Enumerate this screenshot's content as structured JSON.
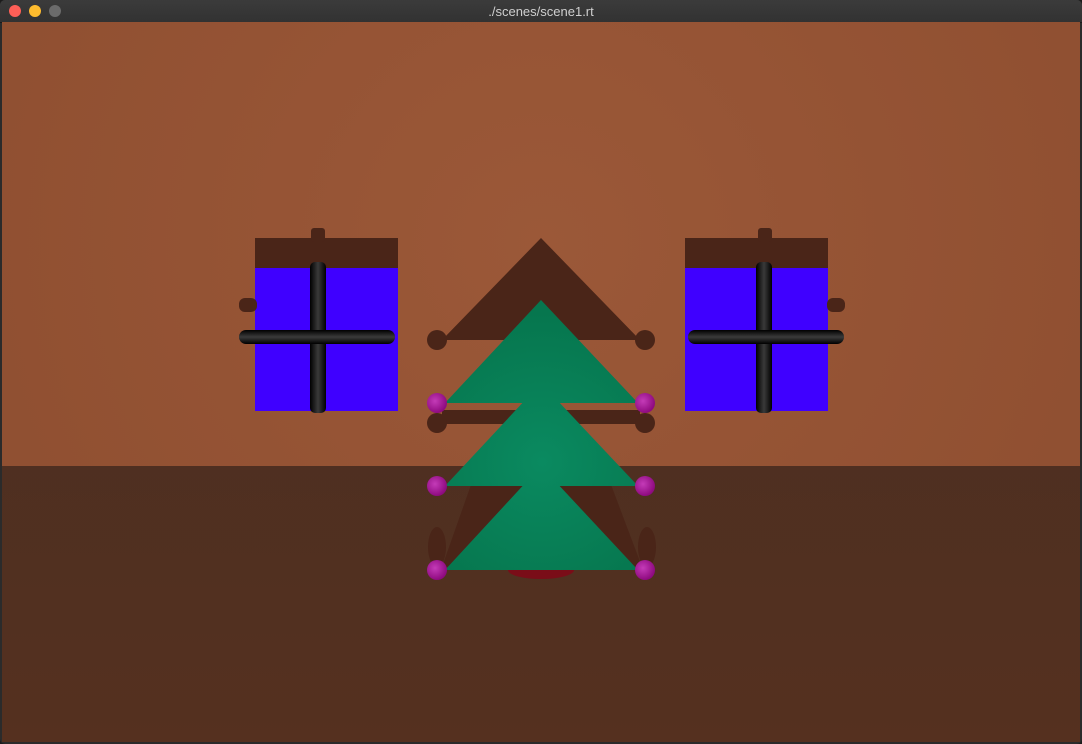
{
  "window": {
    "title": "./scenes/scene1.rt",
    "controls": [
      {
        "name": "close-button",
        "color": "#fe5f57"
      },
      {
        "name": "minimize-button",
        "color": "#febc2e"
      },
      {
        "name": "zoom-button",
        "color": "#6b6b6b"
      }
    ]
  },
  "scene": {
    "wall_color": "#8f4f31",
    "wall_center_color": "#9b5838",
    "floor_color": "#55301f",
    "tree_color": "#06764e",
    "tree_center_color": "#0a8a60",
    "shadow_color": "#4a2518",
    "gift_box_color": "#3f00ff",
    "gift_lid_color": "#4a2518",
    "ribbon_color": "#0b0b0b",
    "ornament_color": "#8e0a7f",
    "trunk_color": "#7a0d18"
  }
}
